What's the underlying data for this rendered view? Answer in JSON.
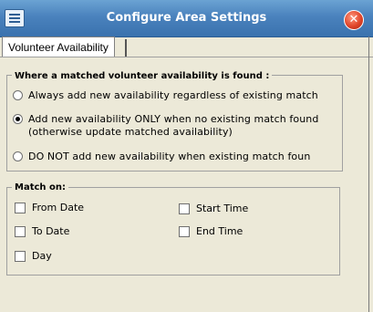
{
  "window": {
    "title": "Configure Area Settings"
  },
  "icons": {
    "app": "list-window-icon",
    "close": "close-icon"
  },
  "tabs": [
    {
      "label": "Volunteer Availability",
      "selected": true
    }
  ],
  "availability_group": {
    "legend": "Where a matched volunteer availability is found :",
    "options": [
      {
        "label": "Always add new availability regardless of existing match",
        "selected": false
      },
      {
        "label": "Add new availability ONLY when no existing match found",
        "label_line2": "(otherwise update matched availability)",
        "selected": true
      },
      {
        "label": "DO NOT add new availability when existing match foun",
        "selected": false
      }
    ]
  },
  "match_group": {
    "legend": "Match on:",
    "items": [
      {
        "label": "From Date",
        "checked": false
      },
      {
        "label": "Start Time",
        "checked": false
      },
      {
        "label": "To Date",
        "checked": false
      },
      {
        "label": "End Time",
        "checked": false
      },
      {
        "label": "Day",
        "checked": false
      }
    ]
  },
  "colors": {
    "titlebar": "#4a82bd",
    "background": "#ece9d8",
    "close": "#e0452a"
  }
}
